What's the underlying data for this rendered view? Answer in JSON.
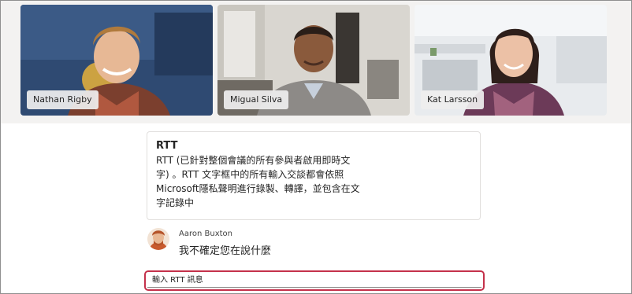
{
  "participants": [
    {
      "name": "Nathan Rigby"
    },
    {
      "name": "Migual Silva"
    },
    {
      "name": "Kat Larsson"
    }
  ],
  "rtt_notice": {
    "title": "RTT",
    "body": "RTT (已針對整個會議的所有參與者啟用即時文字) 。RTT 文字框中的所有輸入交談都會依照Microsoft隱私聲明進行錄製、轉譯，並包含在文字記錄中"
  },
  "message": {
    "sender": "Aaron Buxton",
    "text": "我不確定您在說什麼"
  },
  "composer": {
    "placeholder": "輸入 RTT 訊息"
  },
  "colors": {
    "input_border": "#c4314b",
    "strip_background": "#f3f2f1"
  }
}
